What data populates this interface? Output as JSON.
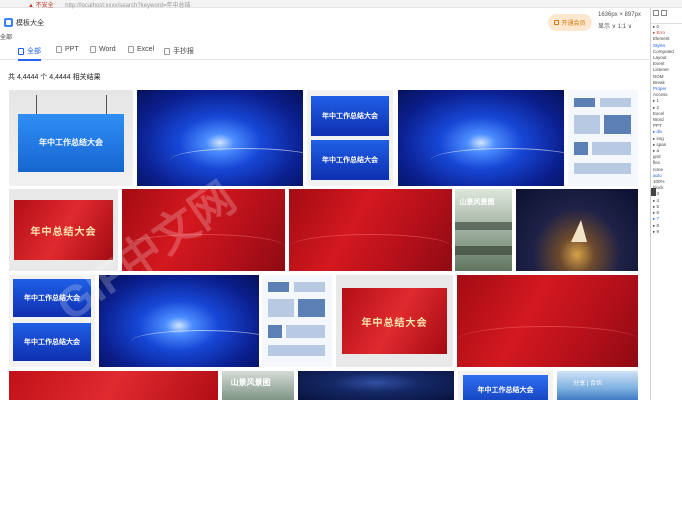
{
  "browser": {
    "security_warning": "▲ 不安全",
    "url": "http://localhost:xxxx/search?keyword=年中总结"
  },
  "app": {
    "title": "模板大全",
    "side_label": "全部"
  },
  "header": {
    "login_label": "开通会员",
    "dimensions": "1636px × 897px",
    "display_menu": "显示 ∨ 1:1 ∨"
  },
  "tabs": [
    {
      "label": "全部"
    },
    {
      "label": "PPT"
    },
    {
      "label": "Word"
    },
    {
      "label": "Excel"
    },
    {
      "label": "手抄报"
    }
  ],
  "results": {
    "count_text": "共 4,4444 个 4,4444 相关结果"
  },
  "thumbnails": [
    {
      "text": "年中工作总结大会"
    },
    {
      "text": ""
    },
    {
      "text": "年中工作总结大会"
    },
    {
      "text": "年中工作总结大会"
    },
    {
      "text": ""
    },
    {
      "text": ""
    },
    {
      "text": "年中总结大会"
    },
    {
      "text": ""
    },
    {
      "text": ""
    },
    {
      "text": "山景风景图"
    },
    {
      "text": ""
    },
    {
      "text": "年中工作总结大会"
    },
    {
      "text": "年中工作总结大会"
    },
    {
      "text": ""
    },
    {
      "text": ""
    },
    {
      "text": "年中总结大会"
    },
    {
      "text": ""
    },
    {
      "text": ""
    },
    {
      "text": "山景风景图"
    },
    {
      "text": ""
    },
    {
      "text": "年中工作总结大会"
    },
    {
      "text": "分享 | 合伙"
    }
  ],
  "watermark": "GIF中文网",
  "devtools": {
    "lines": [
      "▸ 0",
      "▸ Erro",
      "Element",
      "Styles",
      "Computed",
      "Layout",
      "Event",
      "Listener",
      "DOM",
      "Break",
      "Proper",
      "Access",
      "▸ 1",
      "▸ 2",
      "Excel",
      "Word",
      "PPT",
      "▸ div",
      "▸ img",
      "▸ span",
      "▸ a",
      "grid",
      "flex",
      "none",
      "auto",
      "100%",
      "block",
      "▸ 3",
      "▸ 4",
      "▸ 5",
      "▸ 6",
      "▸ 7",
      "▸ 8",
      "▸ 9"
    ]
  }
}
